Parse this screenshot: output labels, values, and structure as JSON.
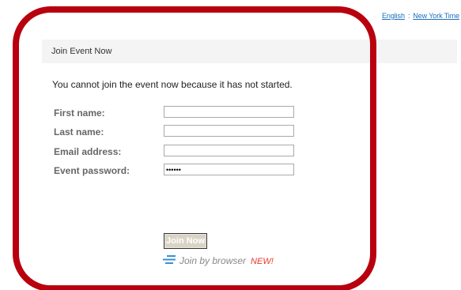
{
  "header": {
    "language_link": "English",
    "separator": ":",
    "timezone_link": "New York Time"
  },
  "panel": {
    "title": "Join Event Now",
    "message": "You cannot join the event now because it has not started."
  },
  "form": {
    "first_name_label": "First name:",
    "first_name_value": "",
    "last_name_label": "Last name:",
    "last_name_value": "",
    "email_label": "Email address:",
    "email_value": "",
    "password_label": "Event password:",
    "password_value": "••••••"
  },
  "actions": {
    "join_now_label": "Join Now",
    "join_browser_label": "Join by browser",
    "new_badge": "NEW!"
  },
  "colors": {
    "highlight_frame": "#b8000e",
    "link": "#1a6fbf",
    "new_badge": "#e8382b"
  },
  "icons": {
    "browser_join": "lines-icon"
  }
}
